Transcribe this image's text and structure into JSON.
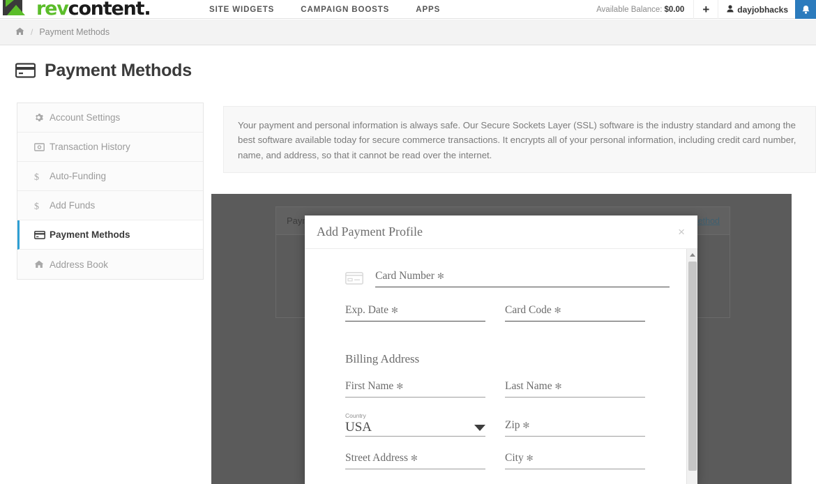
{
  "brand": {
    "name_part1": "rev",
    "name_part2": "content.",
    "accent_color": "#5bbd2a"
  },
  "topnav": {
    "items": [
      {
        "label": "SITE WIDGETS"
      },
      {
        "label": "CAMPAIGN BOOSTS"
      },
      {
        "label": "APPS"
      }
    ],
    "balance_label": "Available Balance:",
    "balance_value": "$0.00",
    "add_funds_label": "+",
    "username": "dayjobhacks",
    "notification_icon": "bell-icon"
  },
  "breadcrumb": {
    "home_icon": "home-icon",
    "separator": "/",
    "current": "Payment Methods"
  },
  "page": {
    "icon": "credit-card-icon",
    "title": "Payment Methods"
  },
  "sidebar": {
    "items": [
      {
        "label": "Account Settings",
        "icon": "gear-icon",
        "active": false
      },
      {
        "label": "Transaction History",
        "icon": "money-bill-icon",
        "active": false
      },
      {
        "label": "Auto-Funding",
        "icon": "dollar-icon",
        "active": false
      },
      {
        "label": "Add Funds",
        "icon": "dollar-icon",
        "active": false
      },
      {
        "label": "Payment Methods",
        "icon": "credit-card-icon",
        "active": true
      },
      {
        "label": "Address Book",
        "icon": "home-icon",
        "active": false
      }
    ]
  },
  "notice": {
    "text": "Your payment and personal information is always safe. Our Secure Sockets Layer (SSL) software is the industry standard and among the best software available today for secure commerce transactions. It encrypts all of your personal information, including credit card number, name, and address, so that it cannot be read over the internet."
  },
  "background_panel": {
    "card_title": "Payment Profiles",
    "card_link": "Add New Payment Method"
  },
  "modal": {
    "title": "Add Payment Profile",
    "close_label": "×",
    "card_icon": "credit-card-icon",
    "fields": {
      "card_number": {
        "label": "Card Number",
        "required_mark": "✻",
        "value": ""
      },
      "exp_date": {
        "label": "Exp. Date",
        "required_mark": "✻",
        "value": ""
      },
      "card_code": {
        "label": "Card Code",
        "required_mark": "✻",
        "value": ""
      },
      "first_name": {
        "label": "First Name",
        "required_mark": "✻",
        "value": ""
      },
      "last_name": {
        "label": "Last Name",
        "required_mark": "✻",
        "value": ""
      },
      "country": {
        "label": "Country",
        "value": "USA",
        "caret_icon": "chevron-down-icon"
      },
      "zip": {
        "label": "Zip",
        "required_mark": "✻",
        "value": ""
      },
      "street": {
        "label": "Street Address",
        "required_mark": "✻",
        "value": ""
      },
      "city": {
        "label": "City",
        "required_mark": "✻",
        "value": ""
      }
    },
    "billing_section_title": "Billing Address"
  }
}
